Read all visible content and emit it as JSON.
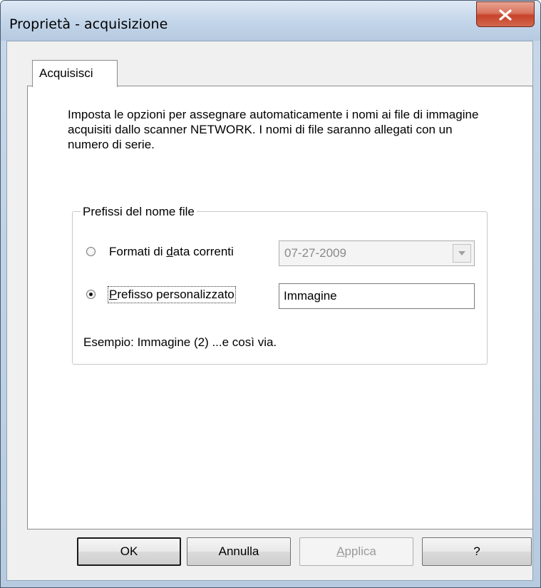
{
  "window": {
    "title": "Proprietà - acquisizione",
    "close_icon": "close-icon",
    "close_color": "#c7432a"
  },
  "tabs": [
    {
      "label": "Acquisisci",
      "selected": true
    }
  ],
  "description": "Imposta le opzioni per assegnare automaticamente i nomi ai file di immagine acquisiti dallo scanner NETWORK. I nomi di file saranno allegati con un numero di serie.",
  "prefix_group": {
    "legend": "Prefissi del nome file",
    "date_option": {
      "label_before": "Formati di ",
      "label_accel": "d",
      "label_after": "ata correnti",
      "checked": false,
      "select_value": "07-27-2009",
      "select_enabled": false
    },
    "custom_option": {
      "label_accel": "P",
      "label_after": "refisso personalizzato",
      "checked": true,
      "input_value": "Immagine"
    },
    "example": "Esempio: Immagine (2) ...e così via."
  },
  "buttons": {
    "ok": "OK",
    "cancel": "Annulla",
    "apply_accel": "A",
    "apply_rest": "pplica",
    "help": "?"
  }
}
